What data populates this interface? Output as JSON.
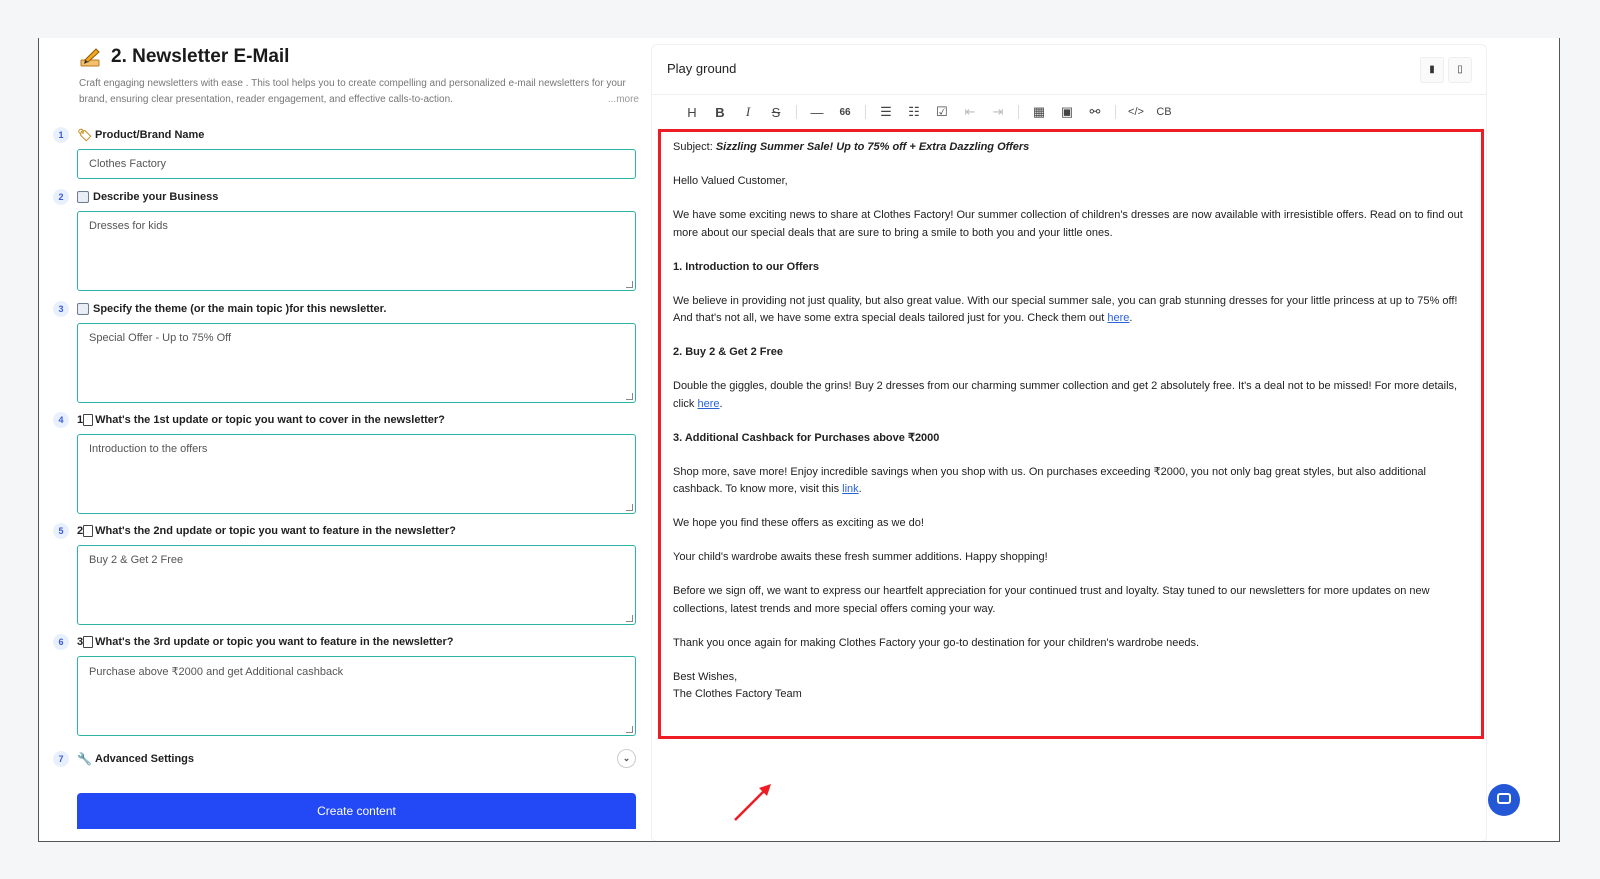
{
  "header": {
    "title": "2. Newsletter E-Mail",
    "description": "Craft engaging newsletters with ease . This tool helps you to create compelling and personalized e-mail newsletters for your brand, ensuring clear presentation, reader engagement, and effective calls-to-action.",
    "more_label": "...more"
  },
  "fields": [
    {
      "num": "1",
      "label": "Product/Brand Name",
      "value": "Clothes Factory",
      "icon": "tag-icon"
    },
    {
      "num": "2",
      "label": "Describe your Business",
      "value": "Dresses for kids",
      "icon": "chart-icon"
    },
    {
      "num": "3",
      "label": "Specify the theme (or the main topic )for this newsletter.",
      "value": "Special Offer - Up to 75% Off",
      "icon": "list-icon"
    },
    {
      "num": "4",
      "label": "What's the 1st update or topic you want to cover in the newsletter?",
      "prefix": "1",
      "value": "Introduction to the offers",
      "icon": "keycap-icon"
    },
    {
      "num": "5",
      "label": "What's the 2nd update or topic you want to feature in the newsletter?",
      "prefix": "2",
      "value": "Buy 2 & Get 2 Free",
      "icon": "keycap-icon"
    },
    {
      "num": "6",
      "label": "What's the 3rd update or topic you want to feature in the newsletter?",
      "prefix": "3",
      "value": "Purchase above ₹2000 and get Additional cashback",
      "icon": "keycap-icon"
    }
  ],
  "advanced": {
    "num": "7",
    "label": "Advanced Settings"
  },
  "create_button": "Create content",
  "playground": {
    "title": "Play ground",
    "toolbar": [
      "H",
      "B",
      "I",
      "S",
      "—",
      "66",
      "ul",
      "ol",
      "check",
      "outdent",
      "indent",
      "table",
      "image",
      "link",
      "</>",
      "CB"
    ],
    "code_block_label": "CB",
    "code_label": "</>",
    "quote_label": "66",
    "heading_label": "H",
    "bold_label": "B",
    "italic_label": "I",
    "strike_label": "S",
    "hr_label": "—"
  },
  "email": {
    "subject_prefix": "Subject: ",
    "subject": "Sizzling Summer Sale! Up to 75% off + Extra Dazzling Offers",
    "greeting": "Hello Valued Customer,",
    "intro": "We have some exciting news to share at Clothes Factory! Our summer collection of children's dresses are now available with irresistible offers. Read on to find out more about our special deals that are sure to bring a smile to both you and your little ones.",
    "h1": "1. Introduction to our Offers",
    "p1": "We believe in providing not just quality, but also great value. With our special summer sale, you can grab stunning dresses for your little princess at up to 75% off! And that's not all, we have some extra special deals tailored just for you. Check them out ",
    "p1_link": "here",
    "h2": "2. Buy 2 & Get 2 Free",
    "p2": "Double the giggles, double the grins! Buy 2 dresses from our charming summer collection and get 2 absolutely free. It's a deal not to be missed! For more details, click ",
    "p2_link": "here",
    "h3": "3. Additional Cashback for Purchases above ₹2000",
    "p3": "Shop more, save more! Enjoy incredible savings when you shop with us. On purchases exceeding ₹2000, you not only bag great styles, but also additional cashback. To know more, visit this ",
    "p3_link": "link",
    "p4": "We hope you find these offers as exciting as we do!",
    "p5": "Your child's wardrobe awaits these fresh summer additions. Happy shopping!",
    "p6": "Before we sign off, we want to express our heartfelt appreciation for your continued trust and loyalty. Stay tuned to our newsletters for more updates on new collections, latest trends and more special offers coming your way.",
    "p7": "Thank you once again for making Clothes Factory your go-to destination for your children's wardrobe needs.",
    "signoff": "Best Wishes,",
    "signature": "The Clothes Factory Team",
    "period": "."
  },
  "colors": {
    "accent": "#2249f5",
    "input_border": "#2bb3a3",
    "highlight": "#ee1c24",
    "link": "#2a63d6"
  }
}
